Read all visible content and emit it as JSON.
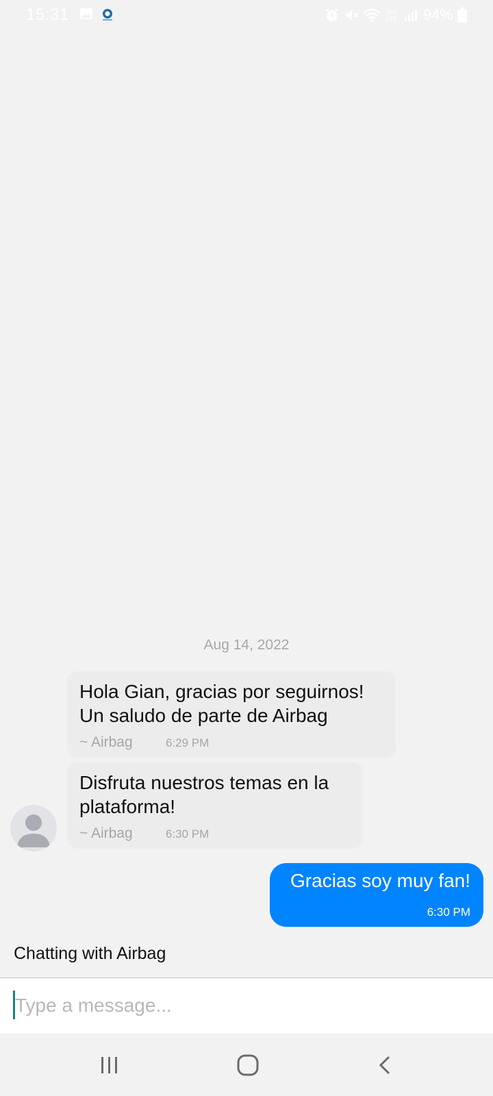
{
  "status_bar": {
    "time": "15:31",
    "battery_percent": "94%",
    "icons": [
      "gallery-icon",
      "app-notification-icon",
      "alarm-icon",
      "mute-icon",
      "wifi-icon",
      "volte-icon",
      "signal-icon",
      "battery-icon"
    ]
  },
  "chat": {
    "date_separator": "Aug 14, 2022",
    "messages": [
      {
        "direction": "incoming",
        "lines": [
          "Hola Gian, gracias por seguirnos!",
          "Un saludo de parte de Airbag"
        ],
        "sender": "~ Airbag",
        "time": "6:29 PM"
      },
      {
        "direction": "incoming",
        "lines": [
          "Disfruta nuestros temas en la",
          "plataforma!"
        ],
        "sender": "~ Airbag",
        "time": "6:30 PM"
      },
      {
        "direction": "outgoing",
        "text": "Gracias soy muy fan!",
        "time": "6:30 PM"
      }
    ],
    "chatting_with": "Chatting with Airbag"
  },
  "composer": {
    "placeholder": "Type a message...",
    "value": ""
  },
  "colors": {
    "background": "#f2f2f2",
    "incoming_bubble": "#ececec",
    "outgoing_bubble": "#0084ff",
    "caret": "#16857a"
  }
}
